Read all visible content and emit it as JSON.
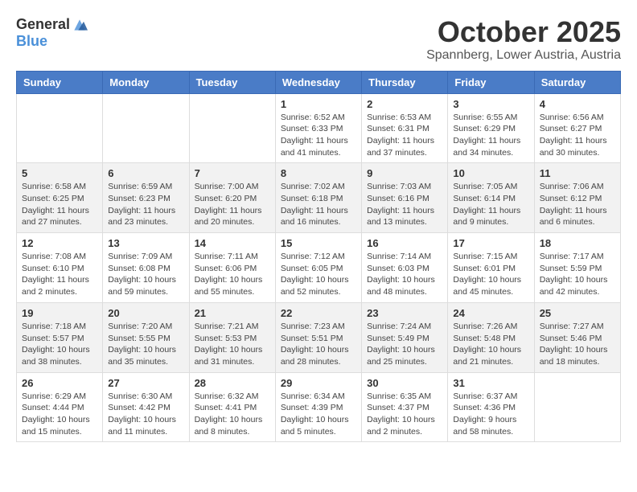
{
  "header": {
    "logo_general": "General",
    "logo_blue": "Blue",
    "month_title": "October 2025",
    "location": "Spannberg, Lower Austria, Austria"
  },
  "weekdays": [
    "Sunday",
    "Monday",
    "Tuesday",
    "Wednesday",
    "Thursday",
    "Friday",
    "Saturday"
  ],
  "weeks": [
    {
      "rowStyle": "white",
      "days": [
        {
          "num": "",
          "info": ""
        },
        {
          "num": "",
          "info": ""
        },
        {
          "num": "",
          "info": ""
        },
        {
          "num": "1",
          "info": "Sunrise: 6:52 AM\nSunset: 6:33 PM\nDaylight: 11 hours\nand 41 minutes."
        },
        {
          "num": "2",
          "info": "Sunrise: 6:53 AM\nSunset: 6:31 PM\nDaylight: 11 hours\nand 37 minutes."
        },
        {
          "num": "3",
          "info": "Sunrise: 6:55 AM\nSunset: 6:29 PM\nDaylight: 11 hours\nand 34 minutes."
        },
        {
          "num": "4",
          "info": "Sunrise: 6:56 AM\nSunset: 6:27 PM\nDaylight: 11 hours\nand 30 minutes."
        }
      ]
    },
    {
      "rowStyle": "gray",
      "days": [
        {
          "num": "5",
          "info": "Sunrise: 6:58 AM\nSunset: 6:25 PM\nDaylight: 11 hours\nand 27 minutes."
        },
        {
          "num": "6",
          "info": "Sunrise: 6:59 AM\nSunset: 6:23 PM\nDaylight: 11 hours\nand 23 minutes."
        },
        {
          "num": "7",
          "info": "Sunrise: 7:00 AM\nSunset: 6:20 PM\nDaylight: 11 hours\nand 20 minutes."
        },
        {
          "num": "8",
          "info": "Sunrise: 7:02 AM\nSunset: 6:18 PM\nDaylight: 11 hours\nand 16 minutes."
        },
        {
          "num": "9",
          "info": "Sunrise: 7:03 AM\nSunset: 6:16 PM\nDaylight: 11 hours\nand 13 minutes."
        },
        {
          "num": "10",
          "info": "Sunrise: 7:05 AM\nSunset: 6:14 PM\nDaylight: 11 hours\nand 9 minutes."
        },
        {
          "num": "11",
          "info": "Sunrise: 7:06 AM\nSunset: 6:12 PM\nDaylight: 11 hours\nand 6 minutes."
        }
      ]
    },
    {
      "rowStyle": "white",
      "days": [
        {
          "num": "12",
          "info": "Sunrise: 7:08 AM\nSunset: 6:10 PM\nDaylight: 11 hours\nand 2 minutes."
        },
        {
          "num": "13",
          "info": "Sunrise: 7:09 AM\nSunset: 6:08 PM\nDaylight: 10 hours\nand 59 minutes."
        },
        {
          "num": "14",
          "info": "Sunrise: 7:11 AM\nSunset: 6:06 PM\nDaylight: 10 hours\nand 55 minutes."
        },
        {
          "num": "15",
          "info": "Sunrise: 7:12 AM\nSunset: 6:05 PM\nDaylight: 10 hours\nand 52 minutes."
        },
        {
          "num": "16",
          "info": "Sunrise: 7:14 AM\nSunset: 6:03 PM\nDaylight: 10 hours\nand 48 minutes."
        },
        {
          "num": "17",
          "info": "Sunrise: 7:15 AM\nSunset: 6:01 PM\nDaylight: 10 hours\nand 45 minutes."
        },
        {
          "num": "18",
          "info": "Sunrise: 7:17 AM\nSunset: 5:59 PM\nDaylight: 10 hours\nand 42 minutes."
        }
      ]
    },
    {
      "rowStyle": "gray",
      "days": [
        {
          "num": "19",
          "info": "Sunrise: 7:18 AM\nSunset: 5:57 PM\nDaylight: 10 hours\nand 38 minutes."
        },
        {
          "num": "20",
          "info": "Sunrise: 7:20 AM\nSunset: 5:55 PM\nDaylight: 10 hours\nand 35 minutes."
        },
        {
          "num": "21",
          "info": "Sunrise: 7:21 AM\nSunset: 5:53 PM\nDaylight: 10 hours\nand 31 minutes."
        },
        {
          "num": "22",
          "info": "Sunrise: 7:23 AM\nSunset: 5:51 PM\nDaylight: 10 hours\nand 28 minutes."
        },
        {
          "num": "23",
          "info": "Sunrise: 7:24 AM\nSunset: 5:49 PM\nDaylight: 10 hours\nand 25 minutes."
        },
        {
          "num": "24",
          "info": "Sunrise: 7:26 AM\nSunset: 5:48 PM\nDaylight: 10 hours\nand 21 minutes."
        },
        {
          "num": "25",
          "info": "Sunrise: 7:27 AM\nSunset: 5:46 PM\nDaylight: 10 hours\nand 18 minutes."
        }
      ]
    },
    {
      "rowStyle": "white",
      "days": [
        {
          "num": "26",
          "info": "Sunrise: 6:29 AM\nSunset: 4:44 PM\nDaylight: 10 hours\nand 15 minutes."
        },
        {
          "num": "27",
          "info": "Sunrise: 6:30 AM\nSunset: 4:42 PM\nDaylight: 10 hours\nand 11 minutes."
        },
        {
          "num": "28",
          "info": "Sunrise: 6:32 AM\nSunset: 4:41 PM\nDaylight: 10 hours\nand 8 minutes."
        },
        {
          "num": "29",
          "info": "Sunrise: 6:34 AM\nSunset: 4:39 PM\nDaylight: 10 hours\nand 5 minutes."
        },
        {
          "num": "30",
          "info": "Sunrise: 6:35 AM\nSunset: 4:37 PM\nDaylight: 10 hours\nand 2 minutes."
        },
        {
          "num": "31",
          "info": "Sunrise: 6:37 AM\nSunset: 4:36 PM\nDaylight: 9 hours\nand 58 minutes."
        },
        {
          "num": "",
          "info": ""
        }
      ]
    }
  ]
}
